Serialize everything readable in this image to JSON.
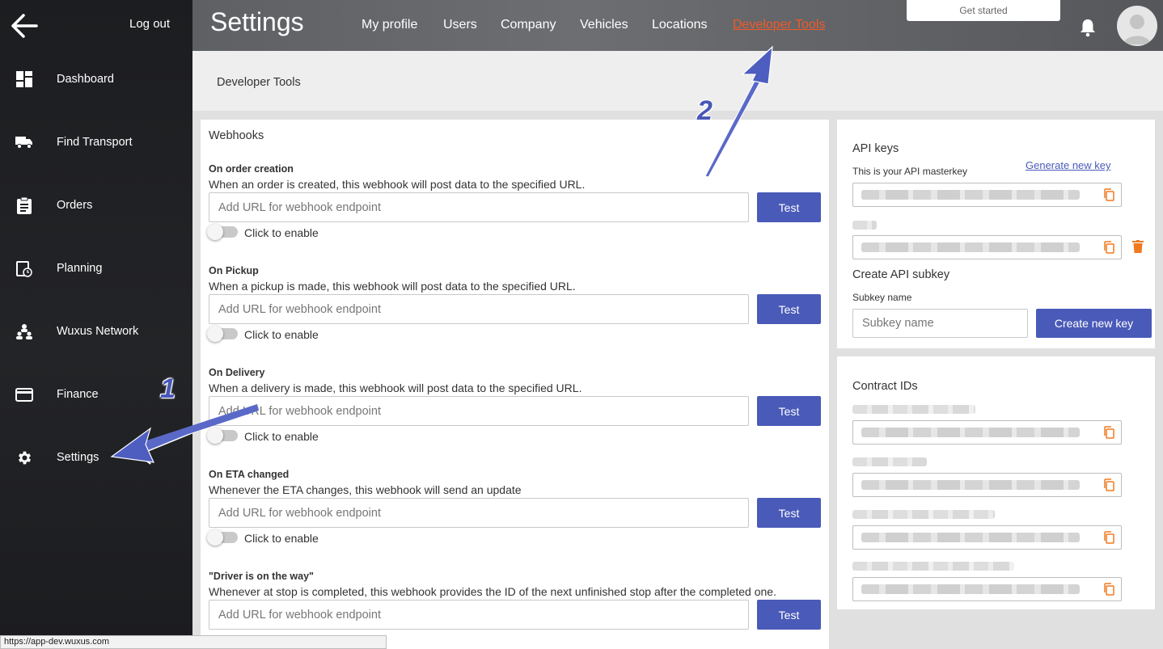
{
  "sidebar": {
    "logout_label": "Log out",
    "items": [
      {
        "label": "Dashboard",
        "icon": "dashboard-icon"
      },
      {
        "label": "Find Transport",
        "icon": "truck-icon"
      },
      {
        "label": "Orders",
        "icon": "clipboard-icon"
      },
      {
        "label": "Planning",
        "icon": "calendar-clock-icon"
      },
      {
        "label": "Wuxus Network",
        "icon": "network-icon"
      },
      {
        "label": "Finance",
        "icon": "credit-card-icon"
      },
      {
        "label": "Settings",
        "icon": "gear-icon"
      }
    ]
  },
  "header": {
    "title": "Settings",
    "tabs": [
      "My profile",
      "Users",
      "Company",
      "Vehicles",
      "Locations",
      "Developer Tools"
    ],
    "active_tab": "Developer Tools",
    "get_started_label": "Get started"
  },
  "breadcrumb": "Developer Tools",
  "webhooks": {
    "title": "Webhooks",
    "input_placeholder": "Add URL for webhook endpoint",
    "test_label": "Test",
    "toggle_label": "Click to enable",
    "items": [
      {
        "heading": "On order creation",
        "description": "When an order is created, this webhook will post data to the specified URL."
      },
      {
        "heading": "On Pickup",
        "description": "When a pickup is made, this webhook will post data to the specified URL."
      },
      {
        "heading": "On Delivery",
        "description": "When a delivery is made, this webhook will post data to the specified URL."
      },
      {
        "heading": "On ETA changed",
        "description": "Whenever the ETA changes, this webhook will send an update"
      },
      {
        "heading": "\"Driver is on the way\"",
        "description": "Whenever at stop is completed, this webhook provides the ID of the next unfinished stop after the completed one."
      }
    ]
  },
  "api_keys": {
    "title": "API keys",
    "master_label": "This is your API masterkey",
    "generate_link": "Generate new key",
    "create_subkey_title": "Create API subkey",
    "subkey_name_label": "Subkey name",
    "subkey_placeholder": "Subkey name",
    "create_button": "Create new key"
  },
  "contracts": {
    "title": "Contract IDs"
  },
  "annotations": {
    "one": "1",
    "two": "2"
  },
  "status_url": "https://app-dev.wuxus.com",
  "colors": {
    "accent": "#4a5ab8",
    "active_tab": "#f05a28",
    "copy_icon": "#f07a20"
  }
}
